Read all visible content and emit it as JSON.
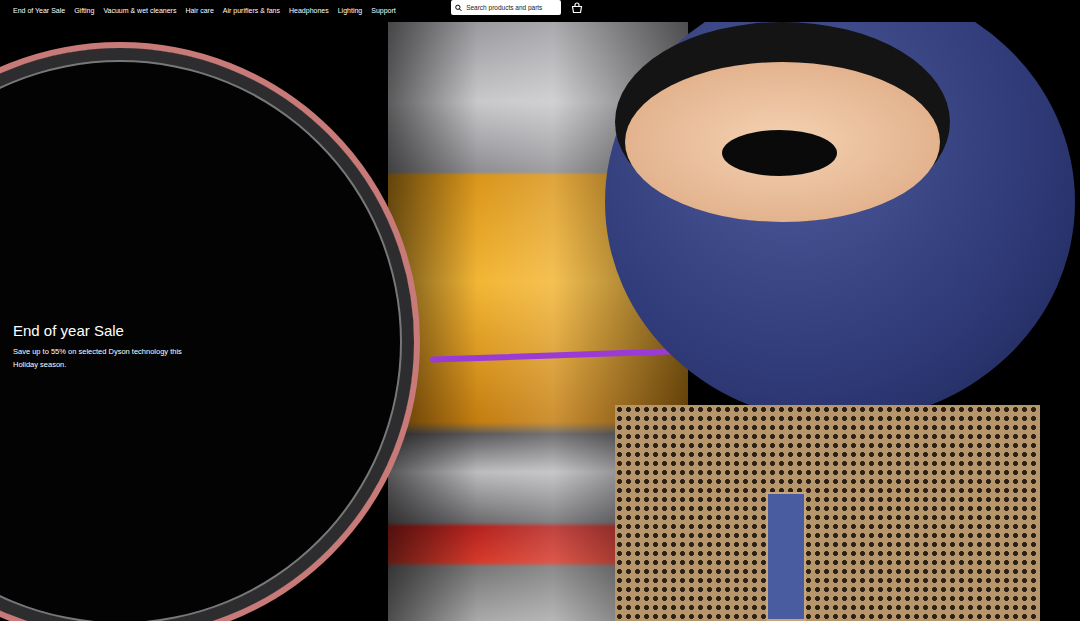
{
  "nav": {
    "items": [
      {
        "label": "End of Year Sale"
      },
      {
        "label": "Gifting"
      },
      {
        "label": "Vacuum & wet cleaners"
      },
      {
        "label": "Hair care"
      },
      {
        "label": "Air purifiers & fans"
      },
      {
        "label": "Headphones"
      },
      {
        "label": "Lighting"
      },
      {
        "label": "Support"
      }
    ]
  },
  "search": {
    "placeholder": "Search products and parts"
  },
  "hero": {
    "title": "End of year Sale",
    "subtitle": "Save up to 55% on selected Dyson technology this Holiday season."
  }
}
